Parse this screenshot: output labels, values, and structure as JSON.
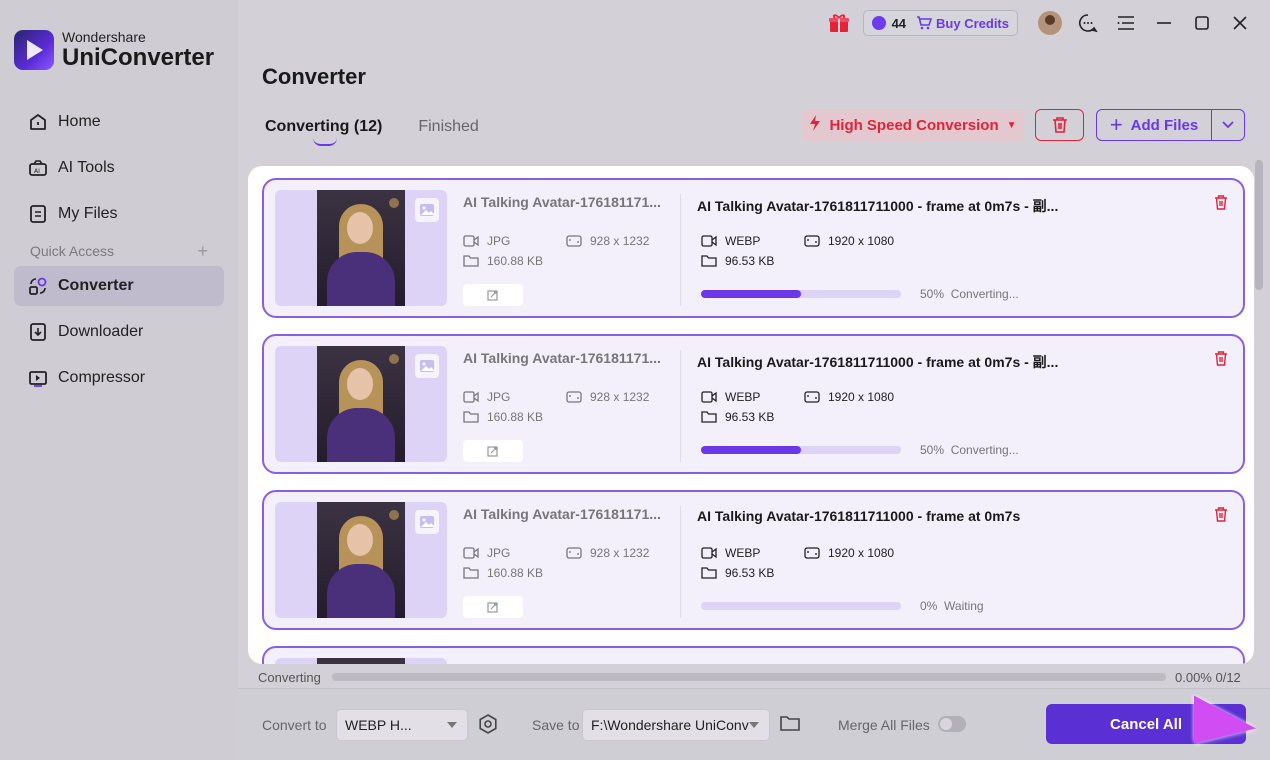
{
  "app": {
    "brand_top": "Wondershare",
    "brand_bottom": "UniConverter"
  },
  "topbar": {
    "credits_count": "44",
    "buy_credits": "Buy Credits"
  },
  "sidebar": {
    "items": [
      {
        "label": "Home",
        "icon": "home-icon"
      },
      {
        "label": "AI Tools",
        "icon": "ai-tools-icon"
      },
      {
        "label": "My Files",
        "icon": "files-icon"
      }
    ],
    "quick_access": "Quick Access",
    "quick_items": [
      {
        "label": "Converter",
        "icon": "converter-icon",
        "active": true
      },
      {
        "label": "Downloader",
        "icon": "downloader-icon"
      },
      {
        "label": "Compressor",
        "icon": "compressor-icon"
      }
    ]
  },
  "main": {
    "title": "Converter",
    "tabs": [
      {
        "label": "Converting (12)",
        "active": true
      },
      {
        "label": "Finished",
        "active": false
      }
    ],
    "high_speed": "High Speed Conversion",
    "add_files": "Add Files"
  },
  "files": [
    {
      "src_name": "AI Talking Avatar-176181171...",
      "src_format": "JPG",
      "src_res": "928 x 1232",
      "src_size": "160.88 KB",
      "dst_name": "AI Talking Avatar-1761811711000 - frame at 0m7s - 副...",
      "dst_format": "WEBP",
      "dst_res": "1920 x 1080",
      "dst_size": "96.53 KB",
      "progress": 50,
      "progress_text": "50%",
      "status": "Converting..."
    },
    {
      "src_name": "AI Talking Avatar-176181171...",
      "src_format": "JPG",
      "src_res": "928 x 1232",
      "src_size": "160.88 KB",
      "dst_name": "AI Talking Avatar-1761811711000 - frame at 0m7s - 副...",
      "dst_format": "WEBP",
      "dst_res": "1920 x 1080",
      "dst_size": "96.53 KB",
      "progress": 50,
      "progress_text": "50%",
      "status": "Converting..."
    },
    {
      "src_name": "AI Talking Avatar-176181171...",
      "src_format": "JPG",
      "src_res": "928 x 1232",
      "src_size": "160.88 KB",
      "dst_name": "AI Talking Avatar-1761811711000 - frame at 0m7s",
      "dst_format": "WEBP",
      "dst_res": "1920 x 1080",
      "dst_size": "96.53 KB",
      "progress": 0,
      "progress_text": "0%",
      "status": "Waiting"
    }
  ],
  "overall": {
    "label": "Converting",
    "value": "0.00% 0/12",
    "progress": 0
  },
  "bottom": {
    "convert_to_label": "Convert to",
    "convert_to_value": "WEBP H...",
    "save_to_label": "Save to",
    "save_to_value": "F:\\Wondershare UniConv",
    "merge_label": "Merge All Files",
    "cancel_all": "Cancel All"
  },
  "colors": {
    "accent": "#6a38e8",
    "danger": "#e2233a"
  }
}
